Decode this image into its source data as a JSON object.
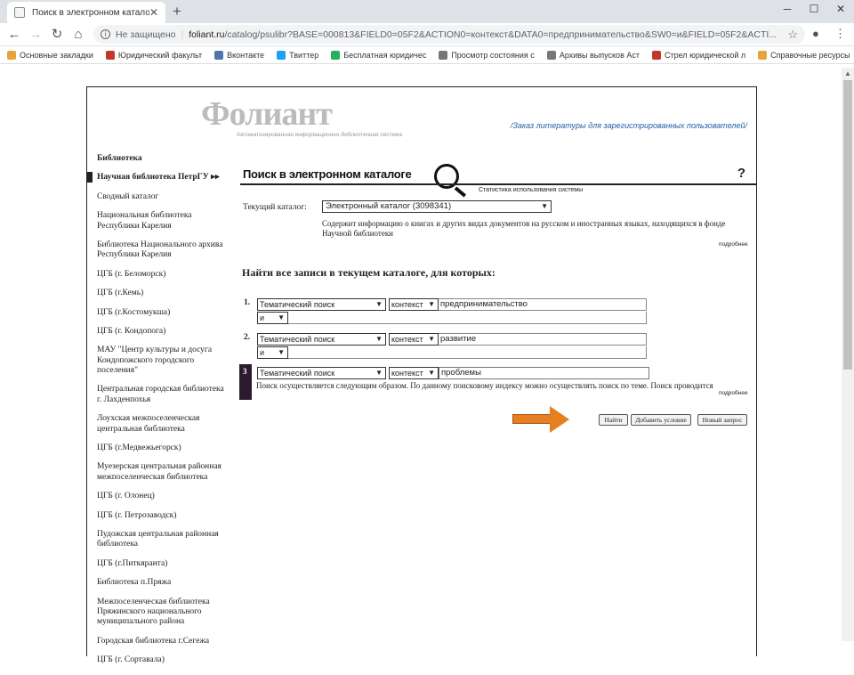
{
  "browser": {
    "tab_title": "Поиск в электронном каталоге",
    "url_status": "Не защищено",
    "url_host": "foliant.ru",
    "url_path": "/catalog/psulibr?BASE=000813&FIELD0=05F2&ACTION0=контекст&DATA0=предпринимательство&SW0=и&FIELD=05F2&ACTI..."
  },
  "bookmarks": [
    {
      "label": "Основные закладки",
      "color": "#e8a33d"
    },
    {
      "label": "Юридический факульт",
      "color": "#c0392b"
    },
    {
      "label": "Вконтакте",
      "color": "#4a76a8"
    },
    {
      "label": "Твиттер",
      "color": "#1da1f2"
    },
    {
      "label": "Бесплатная юридичес",
      "color": "#27ae60"
    },
    {
      "label": "Просмотр состояния с",
      "color": "#777"
    },
    {
      "label": "Архивы выпусков Аст",
      "color": "#777"
    },
    {
      "label": "Стрел юридической л",
      "color": "#c0392b"
    },
    {
      "label": "Справочные ресурсы",
      "color": "#e8a33d"
    }
  ],
  "logo": {
    "word": "Фолиант",
    "sub": "Автоматизированная информационно-библиотечная система"
  },
  "order_link": "/Заказ литературы для зарегистрированных пользователей/",
  "sidebar": {
    "head": "Библиотека",
    "active": "Научная библиотека ПетрГУ ▸▸",
    "items": [
      "Сводный каталог",
      "Национальная библиотека Республики Карелия",
      "Библиотека Национального архива Республики Карелия",
      "ЦГБ (г. Беломорск)",
      "ЦГБ (г.Кемь)",
      "ЦГБ (г.Костомукша)",
      "ЦГБ (г. Кондопога)",
      "МАУ \"Центр культуры и досуга Кондопожского городского поселения\"",
      "Центральная городская библиотека г. Лахденпохья",
      "Лоухская межпоселенческая центральная библиотека",
      "ЦГБ (г.Медвежьегорск)",
      "Муезерская центральная районная межпоселенческая библиотека",
      "ЦГБ (г. Олонец)",
      "ЦГБ (г. Петрозаводск)",
      "Пудожская центральная районная библиотека",
      "ЦГБ (г.Питкяранта)",
      "Библиотека п.Пряжа",
      "Межпоселенческая библиотека Пряжинского национального муниципального района",
      "Городская библиотека г.Сегежа",
      "ЦГБ (г. Сортавала)"
    ]
  },
  "search": {
    "title": "Поиск в электронном каталоге",
    "help": "?",
    "stats_link": "Статистика использования системы",
    "current_catalog_label": "Текущий каталог:",
    "current_catalog_value": "Электронный каталог (3098341)",
    "catalog_desc": "Содержит информацию о книгах и других видах документов на русском и иностранных языках, находящихся в фонде Научной библиотеки",
    "more": "подробнее",
    "find_title": "Найти все записи в текущем каталоге, для которых:",
    "rows": [
      {
        "num": "1.",
        "field": "Тематический поиск",
        "mode": "контекст",
        "value": "предпринимательство",
        "op": "и"
      },
      {
        "num": "2.",
        "field": "Тематический поиск",
        "mode": "контекст",
        "value": "развитие",
        "op": "и"
      },
      {
        "num": "3",
        "field": "Тематический поиск",
        "mode": "контекст",
        "value": "проблемы"
      }
    ],
    "hint": "Поиск осуществляется следующим образом. По данному поисковому индексу можно осуществлять поиск по теме. Поиск проводится",
    "buttons": {
      "find": "Найти",
      "add": "Добавить условие",
      "new": "Новый запрос"
    }
  },
  "colors": {
    "arrow": "#e67e22",
    "link": "#1f5fa8",
    "row3_marker": "#2c1a2e"
  }
}
